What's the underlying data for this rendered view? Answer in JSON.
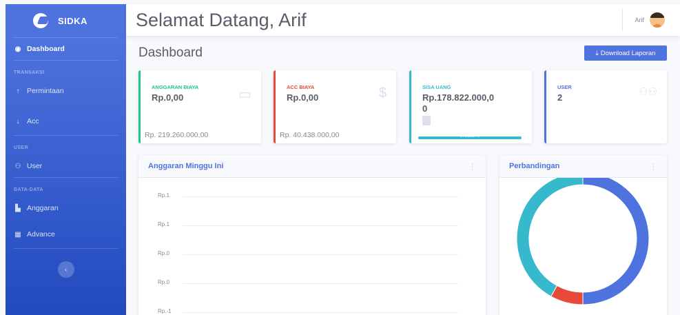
{
  "brand": {
    "name": "SIDKA"
  },
  "sidebar": {
    "dashboard": "Dashboard",
    "heading_transaksi": "TRANSAKSI",
    "permintaan": "Permintaan",
    "acc": "Acc",
    "heading_user": "USER",
    "user": "User",
    "heading_data": "DATA-DATA",
    "anggaran": "Anggaran",
    "advance": "Advance",
    "toggle": "‹"
  },
  "topbar": {
    "greeting": "Selamat Datang, Arif",
    "user_name": "Arif"
  },
  "page": {
    "title": "Dashboard",
    "download_label": "Download Laporan"
  },
  "cards": {
    "anggaran": {
      "label": "ANGGARAN BIAYA",
      "value": "Rp.0,00",
      "footer": "Rp. 219.260.000,00",
      "color": "#1cc88a"
    },
    "acc": {
      "label": "ACC BIAYA",
      "value": "Rp.0,00",
      "footer": "Rp. 40.438.000,00",
      "color": "#e74a3b"
    },
    "sisa": {
      "label": "SISA UANG",
      "value_line1": "Rp.178.822.000,0",
      "value_line2": "0",
      "progress_text": "17882.2 %",
      "progress": 1.0,
      "color": "#36b9cc"
    },
    "user": {
      "label": "USER",
      "value": "2",
      "color": "#4e73df"
    }
  },
  "panels": {
    "weekly": {
      "title": "Anggaran Minggu Ini",
      "y_ticks": [
        "Rp.1",
        "Rp.1",
        "Rp.0",
        "Rp.0",
        "Rp.-1"
      ]
    },
    "compare": {
      "title": "Perbandingan"
    }
  },
  "chart_data": {
    "type": "pie",
    "donut": true,
    "title": "",
    "slices": [
      {
        "value": 50,
        "color": "#4e73df"
      },
      {
        "value": 8,
        "color": "#e74a3b"
      },
      {
        "value": 42,
        "color": "#36b9cc"
      }
    ]
  }
}
